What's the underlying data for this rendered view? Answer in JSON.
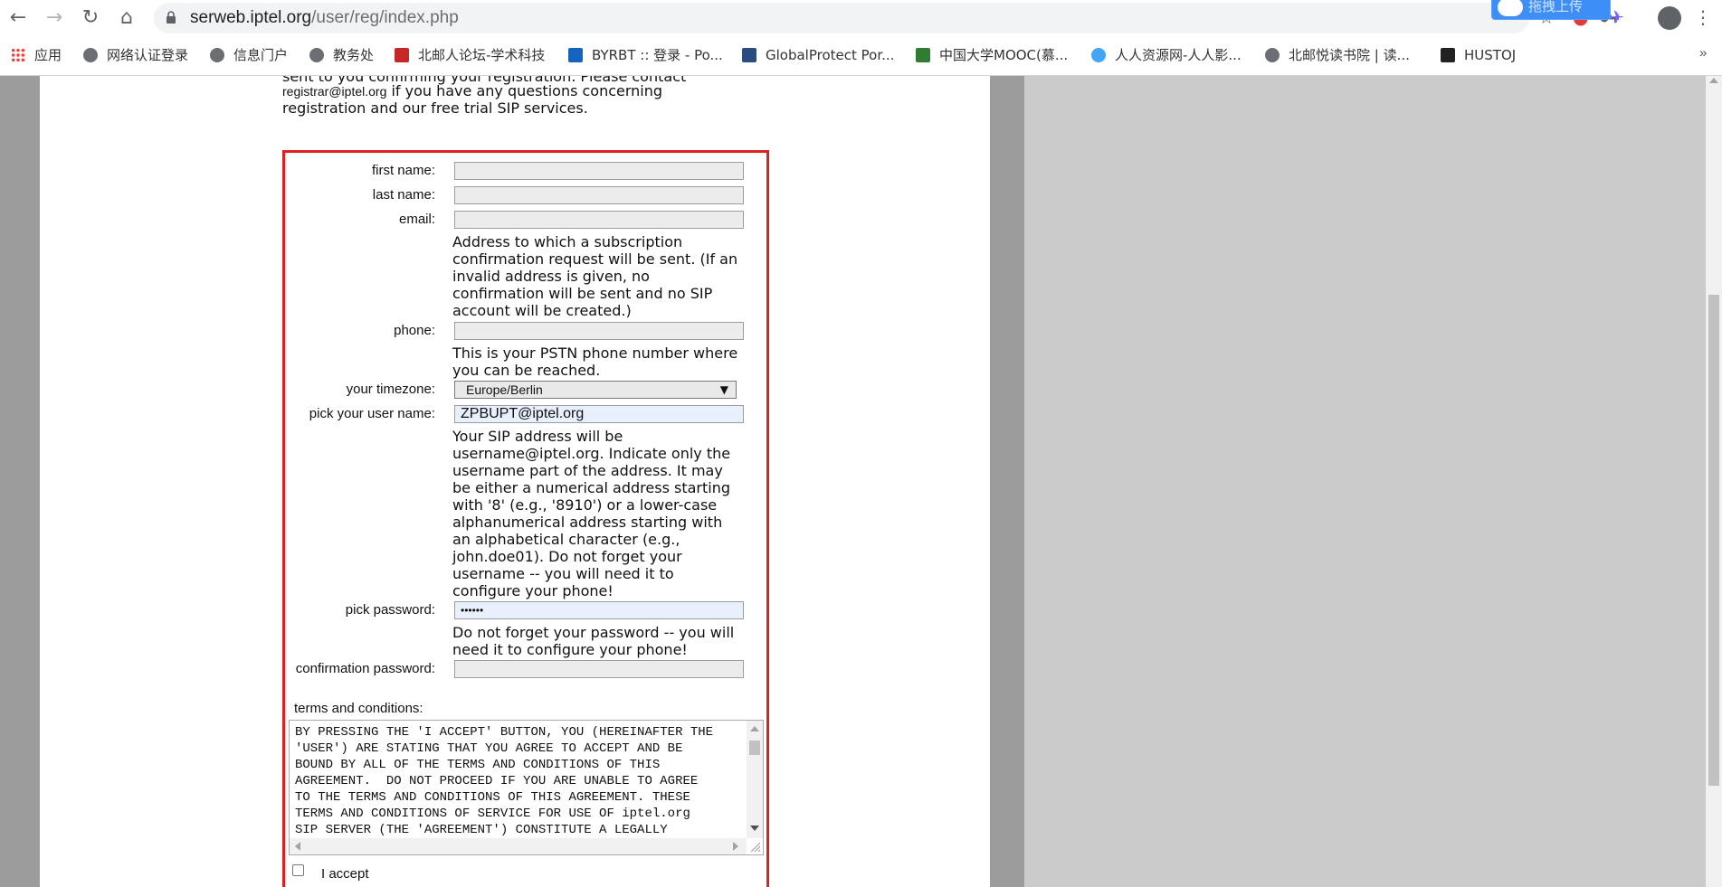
{
  "browser": {
    "url_host": "serweb.iptel.org",
    "url_path": "/user/reg/index.php",
    "upload_badge": "拖拽上传",
    "bookmarks": [
      {
        "label": "应用"
      },
      {
        "label": "网络认证登录"
      },
      {
        "label": "信息门户"
      },
      {
        "label": "教务处"
      },
      {
        "label": "北邮人论坛-学术科技"
      },
      {
        "label": "BYRBT :: 登录 - Po..."
      },
      {
        "label": "GlobalProtect Por..."
      },
      {
        "label": "中国大学MOOC(慕..."
      },
      {
        "label": "人人资源网-人人影..."
      },
      {
        "label": "北邮悦读书院 | 读..."
      },
      {
        "label": "HUSTOJ"
      }
    ],
    "bookmarks_more": "»"
  },
  "intro": {
    "line1": "sent to you confirming your registration. Please contact",
    "line2_email": "registrar@iptel.org",
    "line2_rest": " if you have any questions concerning",
    "line3": "registration and our free trial SIP services."
  },
  "form": {
    "first_name_label": "first name:",
    "first_name_value": "",
    "last_name_label": "last name:",
    "last_name_value": "",
    "email_label": "email:",
    "email_value": "",
    "email_help": "Address to which a subscription confirmation request will be sent. (If an invalid address is given, no confirmation will be sent and no SIP account will be created.)",
    "phone_label": "phone:",
    "phone_value": "",
    "phone_help": "This is your PSTN phone number where you can be reached.",
    "timezone_label": "your timezone:",
    "timezone_value": "Europe/Berlin",
    "username_label": "pick your user name:",
    "username_value": "ZPBUPT@iptel.org",
    "username_help": "Your SIP address will be username@iptel.org. Indicate only the username part of the address. It may be either a numerical address starting with '8' (e.g., '8910') or a lower-case alphanumerical address starting with an alphabetical character (e.g., john.doe01). Do not forget your username -- you will need it to configure your phone!",
    "password_label": "pick password:",
    "password_value": "••••••",
    "password_help": "Do not forget your password -- you will need it to configure your phone!",
    "confirm_label": "confirmation password:",
    "confirm_value": "",
    "terms_label": "terms and conditions:",
    "terms_text": "BY PRESSING THE 'I ACCEPT' BUTTON, YOU (HEREINAFTER THE\n'USER') ARE STATING THAT YOU AGREE TO ACCEPT AND BE\nBOUND BY ALL OF THE TERMS AND CONDITIONS OF THIS\nAGREEMENT.  DO NOT PROCEED IF YOU ARE UNABLE TO AGREE\nTO THE TERMS AND CONDITIONS OF THIS AGREEMENT. THESE\nTERMS AND CONDITIONS OF SERVICE FOR USE OF iptel.org\nSIP SERVER (THE 'AGREEMENT') CONSTITUTE A LEGALLY",
    "accept_label": "I accept"
  },
  "colors": {
    "form_border": "#e02020",
    "autofill_bg": "#e8f0fe"
  }
}
